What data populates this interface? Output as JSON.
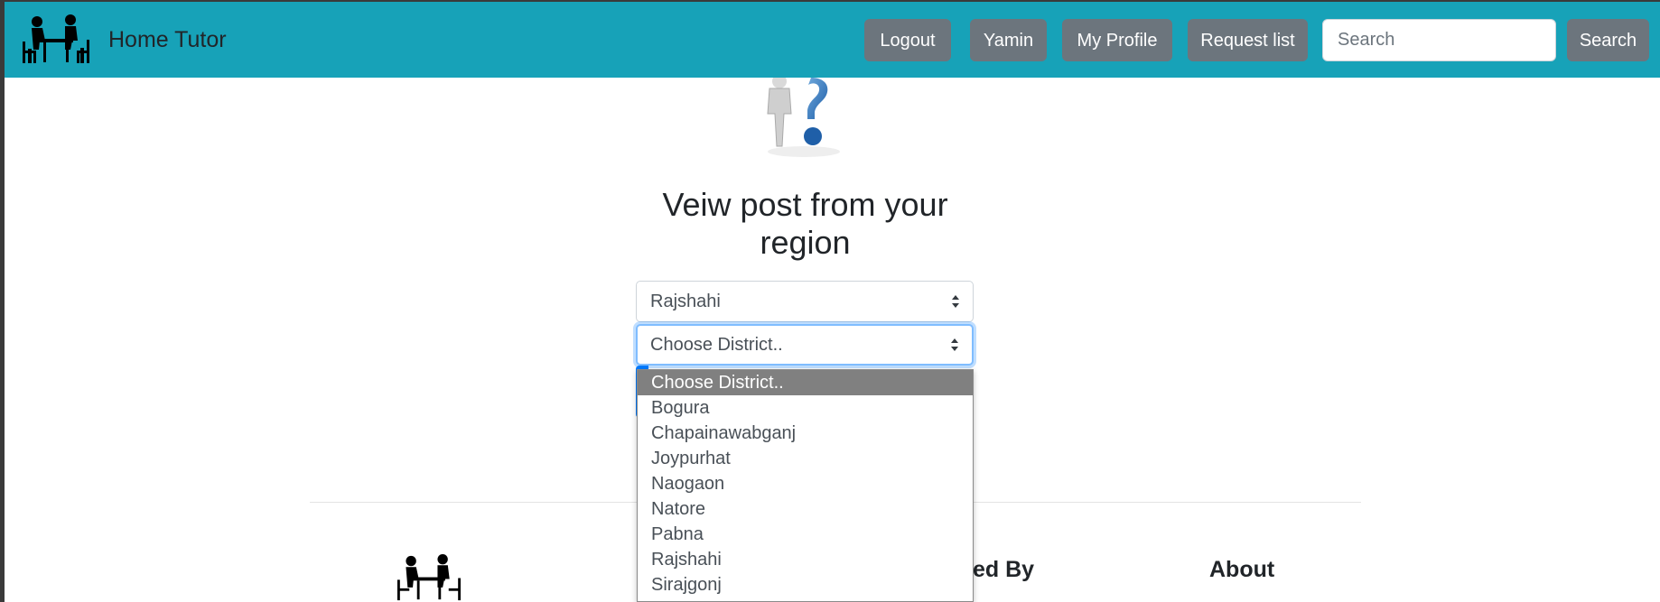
{
  "navbar": {
    "brand": "Home Tutor",
    "logout": "Logout",
    "user": "Yamin",
    "profile": "My Profile",
    "requests": "Request list",
    "search_placeholder": "Search",
    "search_button": "Search",
    "bg_color": "#17a2b8"
  },
  "main": {
    "heading": "Veiw post from your region",
    "division_value": "Rajshahi",
    "district_value": "Choose District.."
  },
  "district_options": [
    "Choose District..",
    "Bogura",
    "Chapainawabganj",
    "Joypurhat",
    "Naogaon",
    "Natore",
    "Pabna",
    "Rajshahi",
    "Sirajgonj"
  ],
  "footer": {
    "heading_partial": "ed By",
    "about": "About"
  }
}
